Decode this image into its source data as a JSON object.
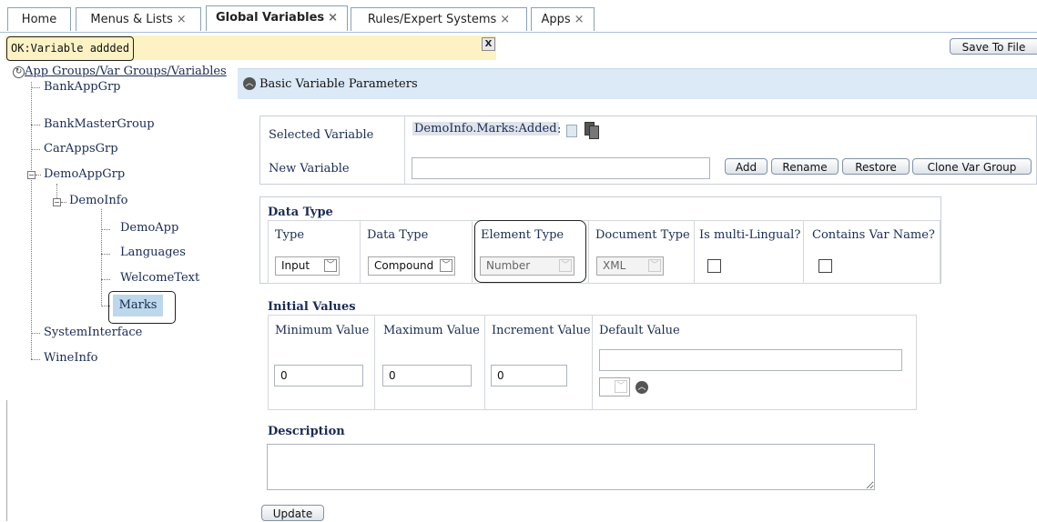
{
  "tabs": [
    {
      "label": "Home",
      "closable": false
    },
    {
      "label": "Menus & Lists",
      "closable": true
    },
    {
      "label": "Global Variables",
      "closable": true,
      "active": true
    },
    {
      "label": "Rules/Expert Systems",
      "closable": true
    },
    {
      "label": "Apps",
      "closable": true
    }
  ],
  "close_glyph": "×",
  "message": {
    "text": "OK:Variable addded",
    "close": "X"
  },
  "save_button": "Save To File",
  "tree": {
    "root": "App Groups/Var Groups/Variables",
    "items": [
      "BankAppGrp",
      "BankMasterGroup",
      "CarAppsGrp",
      "DemoAppGrp",
      "DemoInfo",
      "DemoApp",
      "Languages",
      "WelcomeText",
      "Marks",
      "SystemInterface",
      "WineInfo"
    ]
  },
  "panel": {
    "title": "Basic Variable Parameters",
    "selected_variable_label": "Selected Variable",
    "selected_variable_value": "DemoInfo.Marks:Added",
    "new_variable_label": "New Variable",
    "new_variable_value": "",
    "buttons": {
      "add": "Add",
      "rename": "Rename",
      "restore": "Restore",
      "clone": "Clone Var Group"
    }
  },
  "data_type": {
    "title": "Data Type",
    "columns": {
      "type": {
        "label": "Type",
        "value": "Input"
      },
      "data_type": {
        "label": "Data Type",
        "value": "Compound"
      },
      "element_type": {
        "label": "Element Type",
        "value": "Number"
      },
      "document_type": {
        "label": "Document Type",
        "value": "XML"
      },
      "multi_lingual": {
        "label": "Is multi-Lingual?",
        "checked": false
      },
      "contains_var_name": {
        "label": "Contains Var Name?",
        "checked": false
      }
    }
  },
  "initial_values": {
    "title": "Initial Values",
    "minimum": {
      "label": "Minimum Value",
      "value": "0"
    },
    "maximum": {
      "label": "Maximum Value",
      "value": "0"
    },
    "increment": {
      "label": "Increment Value",
      "value": "0"
    },
    "default": {
      "label": "Default Value",
      "value": ""
    }
  },
  "description": {
    "title": "Description",
    "value": ""
  },
  "update_button": "Update"
}
